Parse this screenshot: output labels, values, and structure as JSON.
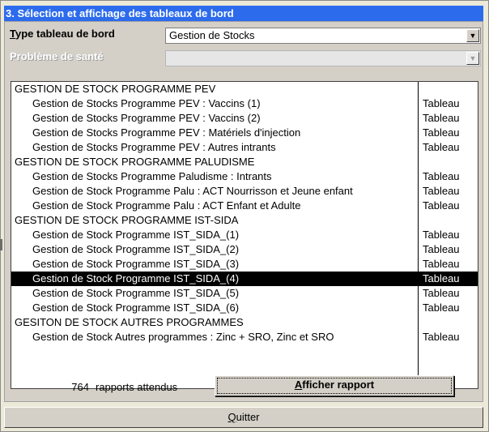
{
  "window": {
    "title": "3. Sélection et affichage des tableaux de bord"
  },
  "form": {
    "type_label_first": "T",
    "type_label_rest": "ype tableau de bord",
    "type_value": "Gestion de Stocks",
    "health_label": "Problème de santé",
    "health_value": ""
  },
  "list": {
    "rows": [
      {
        "name": "GESTION DE STOCK PROGRAMME PEV",
        "type": "",
        "child": false,
        "selected": false
      },
      {
        "name": "Gestion de Stocks Programme PEV : Vaccins (1)",
        "type": "Tableau",
        "child": true,
        "selected": false
      },
      {
        "name": "Gestion de Stocks Programme PEV : Vaccins (2)",
        "type": "Tableau",
        "child": true,
        "selected": false
      },
      {
        "name": "Gestion de Stocks Programme PEV : Matériels d'injection",
        "type": "Tableau",
        "child": true,
        "selected": false
      },
      {
        "name": "Gestion de Stocks Programme PEV : Autres intrants",
        "type": "Tableau",
        "child": true,
        "selected": false
      },
      {
        "name": "GESTION DE STOCK PROGRAMME PALUDISME",
        "type": "",
        "child": false,
        "selected": false
      },
      {
        "name": "Gestion de Stocks Programme Paludisme : Intrants",
        "type": "Tableau",
        "child": true,
        "selected": false
      },
      {
        "name": "Gestion de Stock Programme Palu : ACT Nourrisson et Jeune enfant",
        "type": "Tableau",
        "child": true,
        "selected": false
      },
      {
        "name": "Gestion de Stock Programme Palu : ACT Enfant et Adulte",
        "type": "Tableau",
        "child": true,
        "selected": false
      },
      {
        "name": "GESTION DE STOCK PROGRAMME IST-SIDA",
        "type": "",
        "child": false,
        "selected": false
      },
      {
        "name": "Gestion de Stock Programme IST_SIDA_(1)",
        "type": "Tableau",
        "child": true,
        "selected": false
      },
      {
        "name": "Gestion de Stock Programme IST_SIDA_(2)",
        "type": "Tableau",
        "child": true,
        "selected": false
      },
      {
        "name": "Gestion de Stock Programme IST_SIDA_(3)",
        "type": "Tableau",
        "child": true,
        "selected": false
      },
      {
        "name": "Gestion de Stock Programme IST_SIDA_(4)",
        "type": "Tableau",
        "child": true,
        "selected": true
      },
      {
        "name": "Gestion de Stock Programme IST_SIDA_(5)",
        "type": "Tableau",
        "child": true,
        "selected": false
      },
      {
        "name": "Gestion de Stock Programme IST_SIDA_(6)",
        "type": "Tableau",
        "child": true,
        "selected": false
      },
      {
        "name": "GESITON DE STOCK AUTRES PROGRAMMES",
        "type": "",
        "child": false,
        "selected": false
      },
      {
        "name": "Gestion de Stock Autres programmes : Zinc + SRO, Zinc et SRO",
        "type": "Tableau",
        "child": true,
        "selected": false
      }
    ]
  },
  "footer": {
    "count": "764",
    "count_label": "rapports attendus",
    "show_button_first": "A",
    "show_button_rest": "fficher rapport",
    "quit_first": "Q",
    "quit_rest": "uitter"
  },
  "colors": {
    "title_bar": "#2c6bec",
    "selection": "#000000",
    "panel": "#d4d0c8"
  },
  "icons": {
    "dropdown": "chevron-down-icon"
  }
}
